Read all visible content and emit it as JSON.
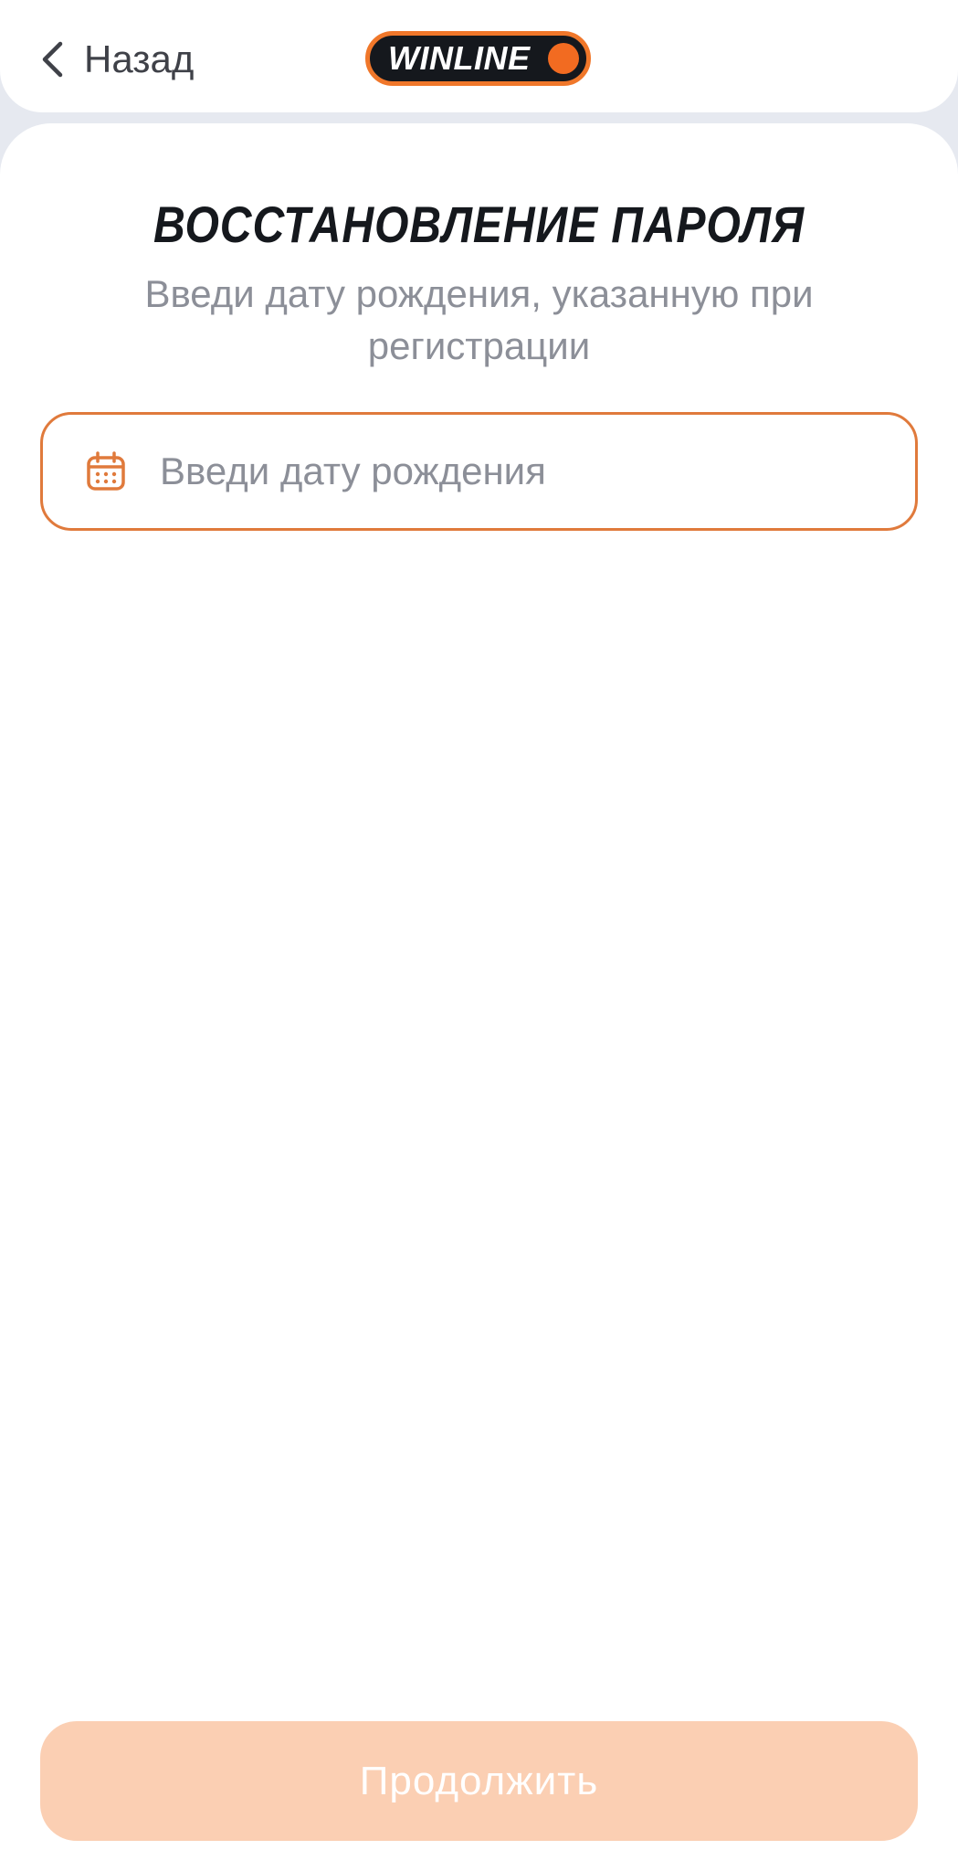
{
  "header": {
    "back_label": "Назад",
    "logo_text": "WINLINE",
    "back_icon": "chevron-left-icon",
    "logo_colors": {
      "fill": "#15181d",
      "accent": "#f26b21"
    }
  },
  "main": {
    "title": "ВОССТАНОВЛЕНИЕ ПАРОЛЯ",
    "subtitle": "Введи дату рождения, указанную при регистрации",
    "birth_date": {
      "icon": "calendar-icon",
      "placeholder": "Введи дату рождения",
      "value": ""
    }
  },
  "footer": {
    "continue_label": "Продолжить",
    "continue_color": "#fbcfb3"
  },
  "colors": {
    "accent": "#f26b21",
    "background": "#e6e9f0",
    "muted_text": "#8c8f98"
  }
}
